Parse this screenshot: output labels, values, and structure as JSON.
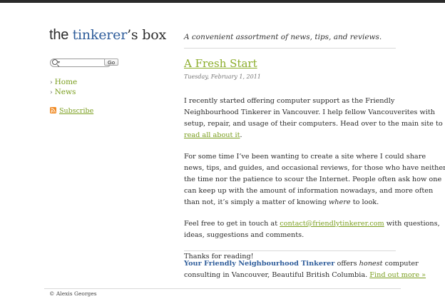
{
  "site": {
    "title_prefix": "the ",
    "title_brand": "tinkerer",
    "title_suffix": "’s box",
    "tagline": "A convenient assortment of news, tips, and reviews."
  },
  "search": {
    "value": "",
    "button_label": "Go"
  },
  "nav": {
    "items": [
      {
        "label": "Home"
      },
      {
        "label": "News"
      }
    ]
  },
  "subscribe": {
    "label": "Subscribe",
    "icon": "rss-icon"
  },
  "post": {
    "title": "A Fresh Start",
    "date": "Tuesday, February 1, 2011",
    "p1": [
      "I recently started offering computer support as the Friendly",
      "Neighbourhood Tinkerer in Vancouver. I help fellow Vancouverites with",
      "setup, repair, and usage of their computers. Head over to the main site to"
    ],
    "p1_link": "read all about it",
    "p1_end": ".",
    "p2": [
      "For some time I’ve been wanting to create a site where I could share",
      "news, tips, and guides, and occasional reviews, for those who have neither",
      "the time nor the patience to scour the Internet. People often ask how one",
      "can keep up with the amount of information nowadays, and more often"
    ],
    "p2_last_pre": "than not, it’s simply a matter of knowing ",
    "p2_last_em": "where",
    "p2_last_post": " to look.",
    "p3_pre": "Feel free to get in touch at ",
    "p3_email": "contact@friendlytinkerer.com",
    "p3_post": " with questions,",
    "p3_line2": "ideas, suggestions and comments.",
    "p4": "Thanks for reading!"
  },
  "promo": {
    "strong": "Your Friendly Neighbourhood Tinkerer",
    "mid": " offers ",
    "em": "honest",
    "after": " computer",
    "line2": "consulting in Vancouver, Beautiful British Columbia. ",
    "link": "Find out more »"
  },
  "footer": {
    "copyright": "© Alexis Georges"
  },
  "colors": {
    "link_green": "#7a9e1e",
    "brand_blue": "#2f5d9b",
    "rss_orange": "#f08a24"
  }
}
